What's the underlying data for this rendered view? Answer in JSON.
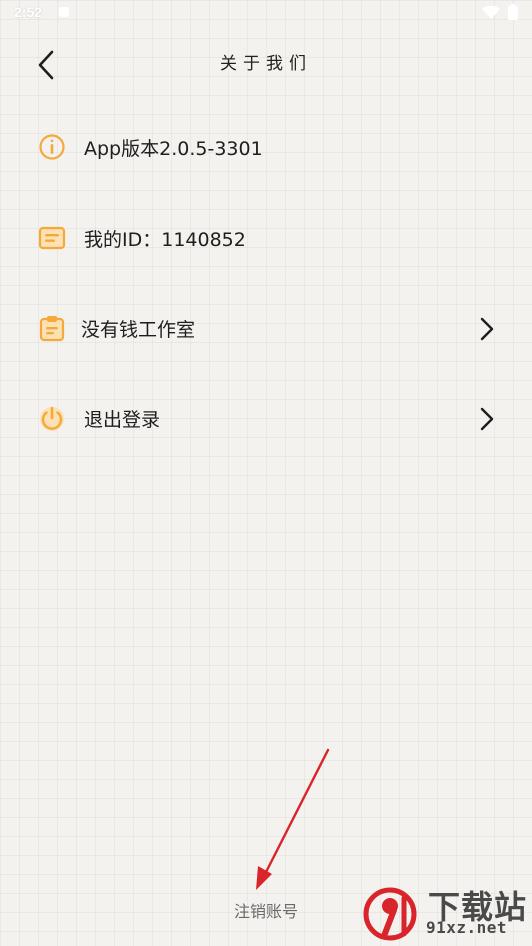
{
  "status_bar": {
    "time": "2:52"
  },
  "header": {
    "title": "关于我们"
  },
  "menu": {
    "items": [
      {
        "id": "version",
        "label": "App版本2.0.5-3301",
        "icon": "info-icon",
        "has_chevron": false
      },
      {
        "id": "user-id",
        "label": "我的ID：1140852",
        "icon": "id-card-icon",
        "has_chevron": false
      },
      {
        "id": "studio",
        "label": "没有钱工作室",
        "icon": "clipboard-icon",
        "has_chevron": true
      },
      {
        "id": "logout",
        "label": "退出登录",
        "icon": "power-icon",
        "has_chevron": true
      }
    ]
  },
  "footer": {
    "deregister_label": "注销账号"
  },
  "watermark": {
    "title": "下载站",
    "domain": "91xz.net"
  },
  "colors": {
    "accent_orange": "#f5a93b",
    "annotation_red": "#d9242b",
    "text_primary": "#1e1e1e",
    "text_muted": "#6a6a6a"
  }
}
